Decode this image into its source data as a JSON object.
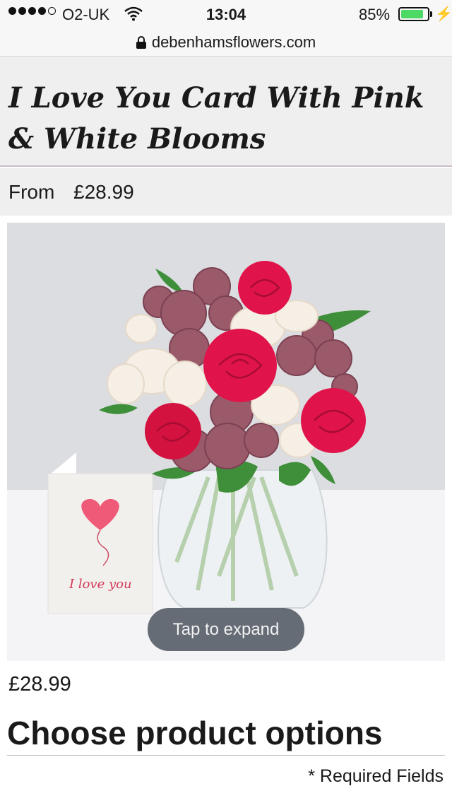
{
  "status_bar": {
    "carrier": "O2-UK",
    "time": "13:04",
    "battery_percent": "85%",
    "battery_level": 0.85,
    "signal_bars": 4,
    "signal_max": 5
  },
  "url_bar": {
    "url": "debenhamsflowers.com"
  },
  "product": {
    "title": "I Love You Card With Pink & White Blooms",
    "from_label": "From",
    "from_price": "£28.99",
    "price": "£28.99",
    "card_text": "I love you"
  },
  "image": {
    "expand_label": "Tap to expand"
  },
  "options": {
    "title": "Choose product options",
    "required_note": "* Required Fields"
  },
  "colors": {
    "battery_green": "#4cd964",
    "rose": "#e0144a",
    "chrysanthemum": "#9a5a6a",
    "heart": "#ef5a78"
  }
}
